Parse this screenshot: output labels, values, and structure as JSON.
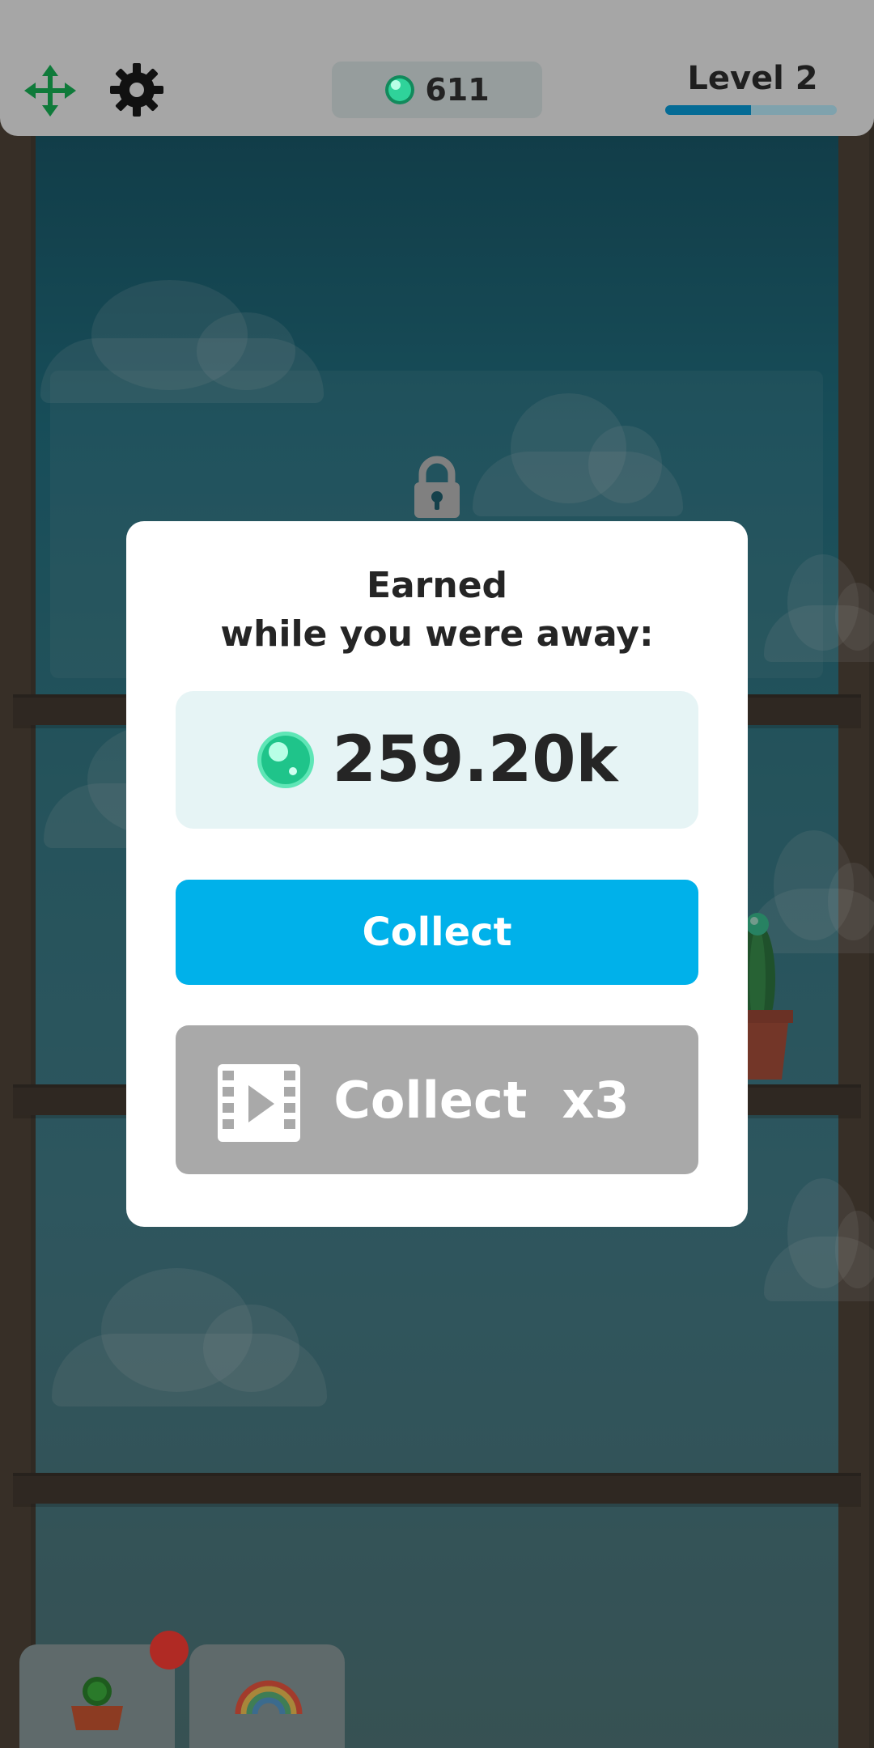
{
  "topbar": {
    "gem_count": "611",
    "level_label": "Level 2",
    "level_progress": 0.5
  },
  "dialog": {
    "title_line1": "Earned",
    "title_line2": "while you were away:",
    "reward_amount": "259.20k",
    "collect_label": "Collect",
    "collect_x3_label": "Collect  x3"
  },
  "icons": {
    "move": "move-arrows-icon",
    "settings": "gear-icon",
    "currency": "green-gem-icon",
    "lock": "lock-icon",
    "video": "film-play-icon",
    "cactus_tab": "cactus-pot-icon",
    "rainbow_tab": "rainbow-icon"
  },
  "colors": {
    "accent_blue": "#00b1ea",
    "gem_green": "#2fd39a",
    "disabled_gray": "#a9a9a9",
    "notification_red": "#b02a24"
  }
}
